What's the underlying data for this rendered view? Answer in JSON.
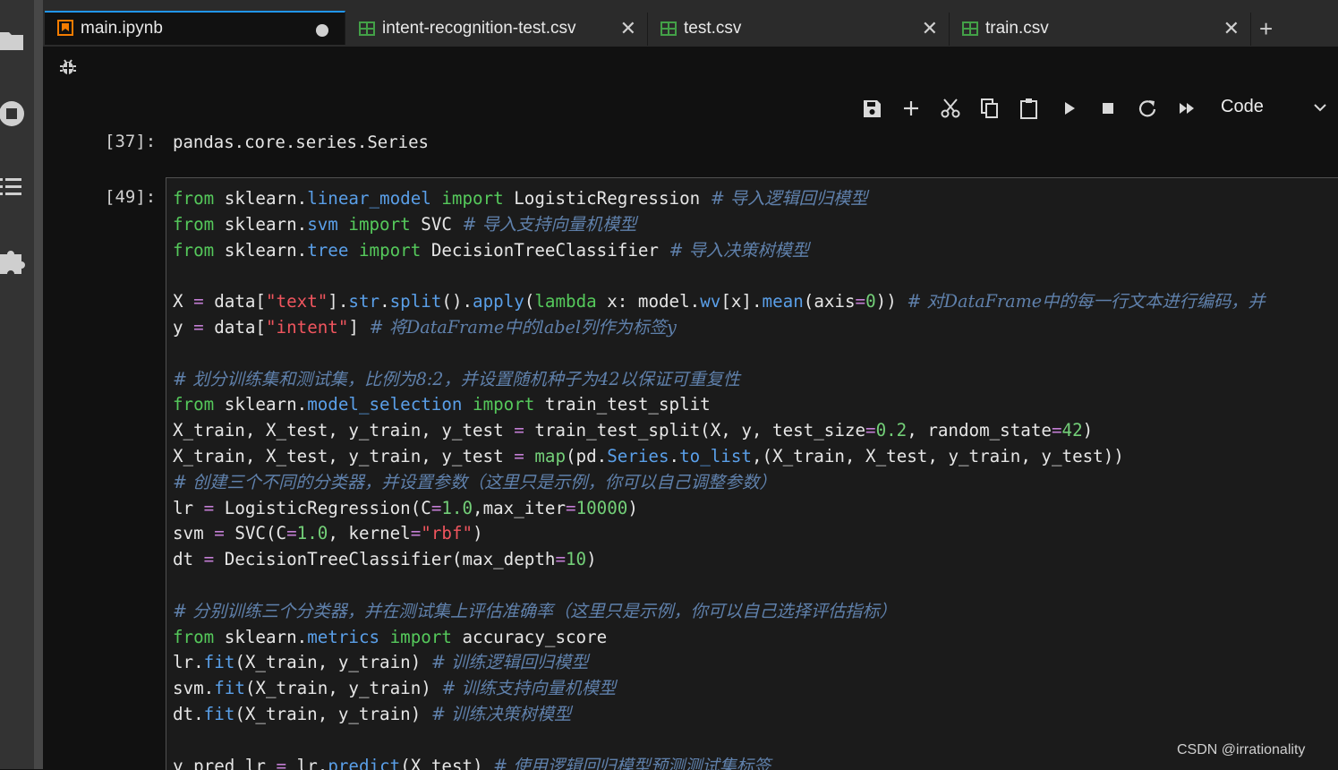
{
  "sidebar": {
    "icons": [
      "folder-icon",
      "running-icon",
      "table-of-contents-icon",
      "extension-icon"
    ]
  },
  "tabs": [
    {
      "label": "main.ipynb",
      "icon": "notebook-icon",
      "active": true,
      "unsaved": true
    },
    {
      "label": "intent-recognition-test.csv",
      "icon": "spreadsheet-icon",
      "active": false
    },
    {
      "label": "test.csv",
      "icon": "spreadsheet-icon",
      "active": false
    },
    {
      "label": "train.csv",
      "icon": "spreadsheet-icon",
      "active": false
    }
  ],
  "tab_close_glyph": "✕",
  "new_tab_glyph": "+",
  "toolbar": {
    "buttons": [
      "save-icon",
      "add-cell-icon",
      "cut-icon",
      "copy-icon",
      "paste-icon",
      "run-icon",
      "stop-icon",
      "restart-icon",
      "run-all-icon"
    ],
    "cell_type": "Code"
  },
  "cells": {
    "output_prompt": "[37]:",
    "output_text": "pandas.core.series.Series",
    "input_prompt": "[49]:"
  },
  "code_lines": [
    [
      [
        "kw",
        "from"
      ],
      [
        "t",
        " sklearn."
      ],
      [
        "at",
        "linear_model"
      ],
      [
        "t",
        " "
      ],
      [
        "kw",
        "import"
      ],
      [
        "t",
        " LogisticRegression "
      ],
      [
        "cm",
        "# 导入逻辑回归模型"
      ]
    ],
    [
      [
        "kw",
        "from"
      ],
      [
        "t",
        " sklearn."
      ],
      [
        "at",
        "svm"
      ],
      [
        "t",
        " "
      ],
      [
        "kw",
        "import"
      ],
      [
        "t",
        " SVC "
      ],
      [
        "cm",
        "# 导入支持向量机模型"
      ]
    ],
    [
      [
        "kw",
        "from"
      ],
      [
        "t",
        " sklearn."
      ],
      [
        "at",
        "tree"
      ],
      [
        "t",
        " "
      ],
      [
        "kw",
        "import"
      ],
      [
        "t",
        " DecisionTreeClassifier "
      ],
      [
        "cm",
        "# 导入决策树模型"
      ]
    ],
    [],
    [
      [
        "t",
        "X "
      ],
      [
        "op",
        "="
      ],
      [
        "t",
        " data["
      ],
      [
        "st",
        "\"text\""
      ],
      [
        "t",
        "]."
      ],
      [
        "at",
        "str"
      ],
      [
        "t",
        "."
      ],
      [
        "at",
        "split"
      ],
      [
        "t",
        "()."
      ],
      [
        "at",
        "apply"
      ],
      [
        "t",
        "("
      ],
      [
        "kw",
        "lambda"
      ],
      [
        "t",
        " x: model."
      ],
      [
        "at",
        "wv"
      ],
      [
        "t",
        "[x]."
      ],
      [
        "at",
        "mean"
      ],
      [
        "t",
        "(axis"
      ],
      [
        "op",
        "="
      ],
      [
        "nm",
        "0"
      ],
      [
        "t",
        ")) "
      ],
      [
        "cm",
        "# 对DataFrame中的每一行文本进行编码，并"
      ]
    ],
    [
      [
        "t",
        "y "
      ],
      [
        "op",
        "="
      ],
      [
        "t",
        " data["
      ],
      [
        "st",
        "\"intent\""
      ],
      [
        "t",
        "] "
      ],
      [
        "cm",
        "# 将DataFrame中的label列作为标签y"
      ]
    ],
    [],
    [
      [
        "cm",
        "# 划分训练集和测试集，比例为8:2，并设置随机种子为42以保证可重复性"
      ]
    ],
    [
      [
        "kw",
        "from"
      ],
      [
        "t",
        " sklearn."
      ],
      [
        "at",
        "model_selection"
      ],
      [
        "t",
        " "
      ],
      [
        "kw",
        "import"
      ],
      [
        "t",
        " train_test_split"
      ]
    ],
    [
      [
        "t",
        "X_train, X_test, y_train, y_test "
      ],
      [
        "op",
        "="
      ],
      [
        "t",
        " train_test_split(X, y, test_size"
      ],
      [
        "op",
        "="
      ],
      [
        "nm",
        "0.2"
      ],
      [
        "t",
        ", random_state"
      ],
      [
        "op",
        "="
      ],
      [
        "nm",
        "42"
      ],
      [
        "t",
        ")"
      ]
    ],
    [
      [
        "t",
        "X_train, X_test, y_train, y_test "
      ],
      [
        "op",
        "="
      ],
      [
        "t",
        " "
      ],
      [
        "nm",
        "map"
      ],
      [
        "t",
        "(pd."
      ],
      [
        "at",
        "Series"
      ],
      [
        "t",
        "."
      ],
      [
        "at",
        "to_list"
      ],
      [
        "t",
        ",(X_train, X_test, y_train, y_test))"
      ]
    ],
    [
      [
        "cm",
        "# 创建三个不同的分类器，并设置参数（这里只是示例，你可以自己调整参数）"
      ]
    ],
    [
      [
        "t",
        "lr "
      ],
      [
        "op",
        "="
      ],
      [
        "t",
        " LogisticRegression(C"
      ],
      [
        "op",
        "="
      ],
      [
        "nm",
        "1.0"
      ],
      [
        "t",
        ",max_iter"
      ],
      [
        "op",
        "="
      ],
      [
        "nm",
        "10000"
      ],
      [
        "t",
        ")"
      ]
    ],
    [
      [
        "t",
        "svm "
      ],
      [
        "op",
        "="
      ],
      [
        "t",
        " SVC(C"
      ],
      [
        "op",
        "="
      ],
      [
        "nm",
        "1.0"
      ],
      [
        "t",
        ", kernel"
      ],
      [
        "op",
        "="
      ],
      [
        "st",
        "\"rbf\""
      ],
      [
        "t",
        ")"
      ]
    ],
    [
      [
        "t",
        "dt "
      ],
      [
        "op",
        "="
      ],
      [
        "t",
        " DecisionTreeClassifier(max_depth"
      ],
      [
        "op",
        "="
      ],
      [
        "nm",
        "10"
      ],
      [
        "t",
        ")"
      ]
    ],
    [],
    [
      [
        "cm",
        "# 分别训练三个分类器，并在测试集上评估准确率（这里只是示例，你可以自己选择评估指标）"
      ]
    ],
    [
      [
        "kw",
        "from"
      ],
      [
        "t",
        " sklearn."
      ],
      [
        "at",
        "metrics"
      ],
      [
        "t",
        " "
      ],
      [
        "kw",
        "import"
      ],
      [
        "t",
        " accuracy_score"
      ]
    ],
    [
      [
        "t",
        "lr."
      ],
      [
        "at",
        "fit"
      ],
      [
        "t",
        "(X_train, y_train) "
      ],
      [
        "cm",
        "# 训练逻辑回归模型"
      ]
    ],
    [
      [
        "t",
        "svm."
      ],
      [
        "at",
        "fit"
      ],
      [
        "t",
        "(X_train, y_train) "
      ],
      [
        "cm",
        "# 训练支持向量机模型"
      ]
    ],
    [
      [
        "t",
        "dt."
      ],
      [
        "at",
        "fit"
      ],
      [
        "t",
        "(X_train, y_train) "
      ],
      [
        "cm",
        "# 训练决策树模型"
      ]
    ],
    [],
    [
      [
        "t",
        "y_pred_lr "
      ],
      [
        "op",
        "="
      ],
      [
        "t",
        " lr."
      ],
      [
        "at",
        "predict"
      ],
      [
        "t",
        "(X_test) "
      ],
      [
        "cm",
        "# 使用逻辑回归模型预测测试集标签"
      ]
    ]
  ],
  "watermark": "CSDN @irrationality"
}
